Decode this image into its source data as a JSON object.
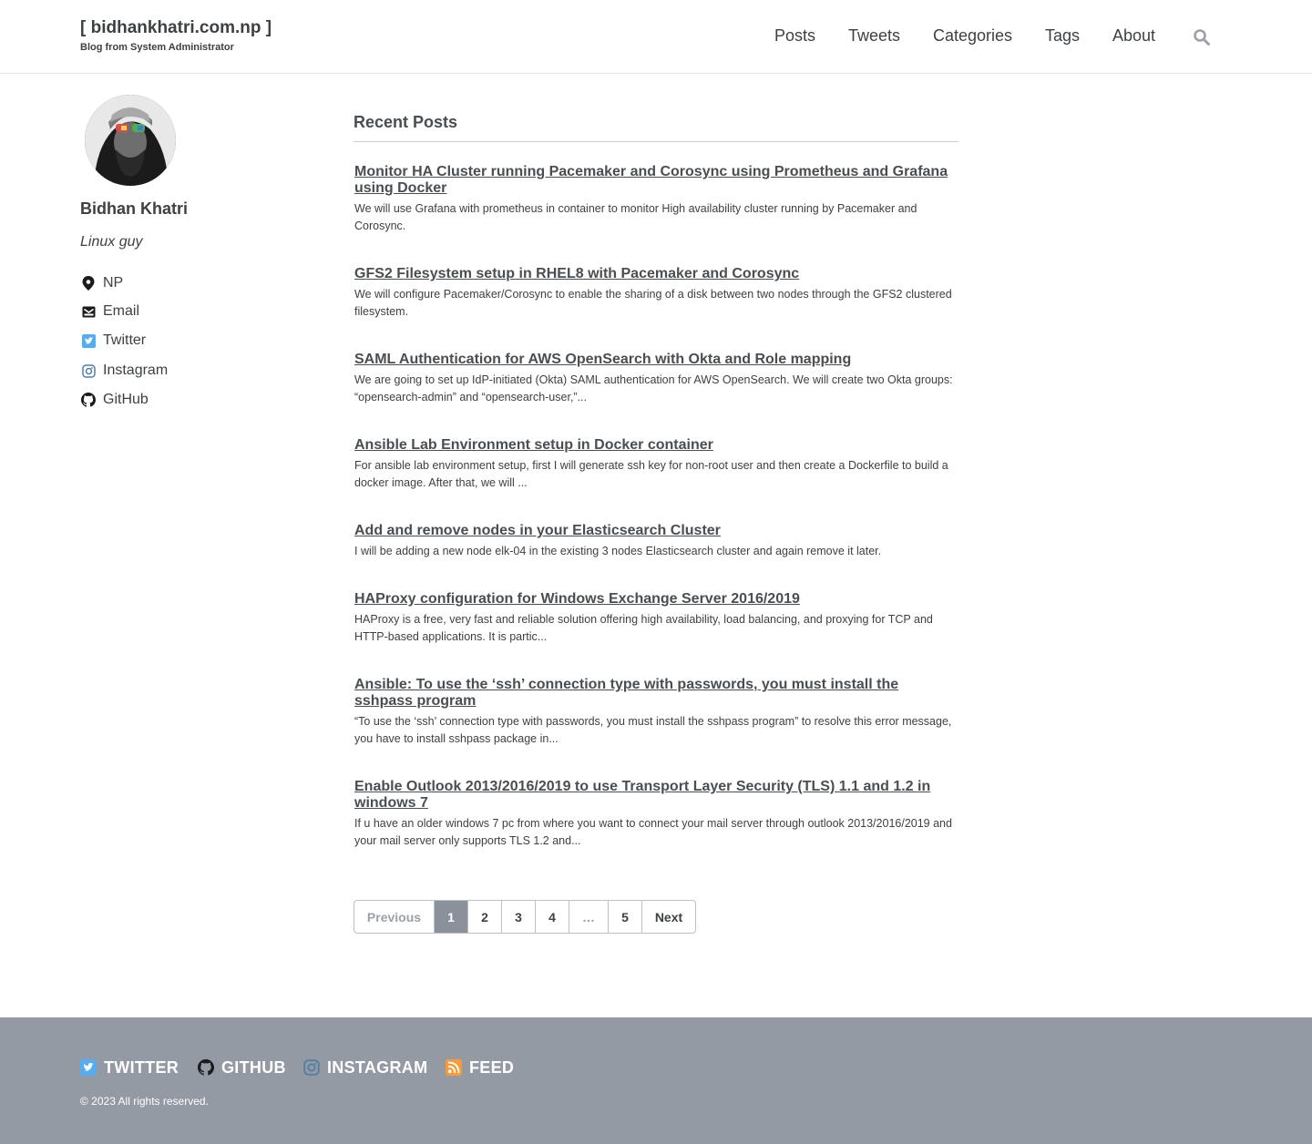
{
  "header": {
    "site_title": "[ bidhankhatri.com.np ]",
    "site_subtitle": "Blog from System Administrator",
    "nav": [
      "Posts",
      "Tweets",
      "Categories",
      "Tags",
      "About"
    ],
    "search_icon": "search-icon"
  },
  "sidebar": {
    "author_name": "Bidhan Khatri",
    "author_bio": "Linux guy",
    "links": [
      {
        "label": "NP",
        "icon": "location-pin-icon"
      },
      {
        "label": "Email",
        "icon": "envelope-icon"
      },
      {
        "label": "Twitter",
        "icon": "twitter-icon"
      },
      {
        "label": "Instagram",
        "icon": "instagram-icon"
      },
      {
        "label": "GitHub",
        "icon": "github-icon"
      }
    ]
  },
  "main": {
    "heading": "Recent Posts",
    "posts": [
      {
        "title": "Monitor HA Cluster running Pacemaker and Corosync using Prometheus and Grafana using Docker",
        "excerpt": "We will use Grafana with prometheus in container to monitor High availability cluster running by Pacemaker and Corosync."
      },
      {
        "title": "GFS2 Filesystem setup in RHEL8 with Pacemaker and Corosync",
        "excerpt": "We will configure Pacemaker/Corosync to enable the sharing of a disk between two nodes through the GFS2 clustered filesystem."
      },
      {
        "title": "SAML Authentication for AWS OpenSearch with Okta and Role mapping",
        "excerpt": "We are going to set up IdP-initiated (Okta) SAML authentication for AWS OpenSearch. We will create two Okta groups: “opensearch-admin” and “opensearch-user,”..."
      },
      {
        "title": "Ansible Lab Environment setup in Docker container",
        "excerpt": "For ansible lab environment setup, first I will generate ssh key for non-root user and then create a Dockerfile to build a docker image. After that, we will ..."
      },
      {
        "title": "Add and remove nodes in your Elasticsearch Cluster",
        "excerpt": "I will be adding a new node elk-04 in the existing 3 nodes Elasticsearch cluster and again remove it later."
      },
      {
        "title": "HAProxy configuration for Windows Exchange Server 2016/2019",
        "excerpt": "HAProxy is a free, very fast and reliable solution offering high availability, load balancing, and proxying for TCP and HTTP-based applications. It is partic..."
      },
      {
        "title": "Ansible: To use the ‘ssh’ connection type with passwords, you must install the sshpass program",
        "excerpt": "“To use the ‘ssh’ connection type with passwords, you must install the sshpass program” to resolve this error message, you have to install sshpass package in..."
      },
      {
        "title": "Enable Outlook 2013/2016/2019 to use Transport Layer Security (TLS) 1.1 and 1.2 in windows 7",
        "excerpt": "If u have an older windows 7 pc from where you want to connect your mail server through outlook 2013/2016/2019 and your mail server only supports TLS 1.2 and..."
      }
    ]
  },
  "pagination": {
    "previous": "Previous",
    "pages": [
      "1",
      "2",
      "3",
      "4",
      "…",
      "5"
    ],
    "current": "1",
    "next": "Next"
  },
  "footer": {
    "links": [
      {
        "label": "TWITTER",
        "icon": "twitter-icon"
      },
      {
        "label": "GITHUB",
        "icon": "github-icon"
      },
      {
        "label": "INSTAGRAM",
        "icon": "instagram-icon"
      },
      {
        "label": "FEED",
        "icon": "rss-icon"
      }
    ],
    "copyright": "© 2023 All rights reserved."
  },
  "colors": {
    "twitter": "#55acee",
    "instagram": "#517fa4",
    "rss": "#fa9b39",
    "footer_bg": "#949aa3",
    "pager_current": "#8b919a"
  }
}
